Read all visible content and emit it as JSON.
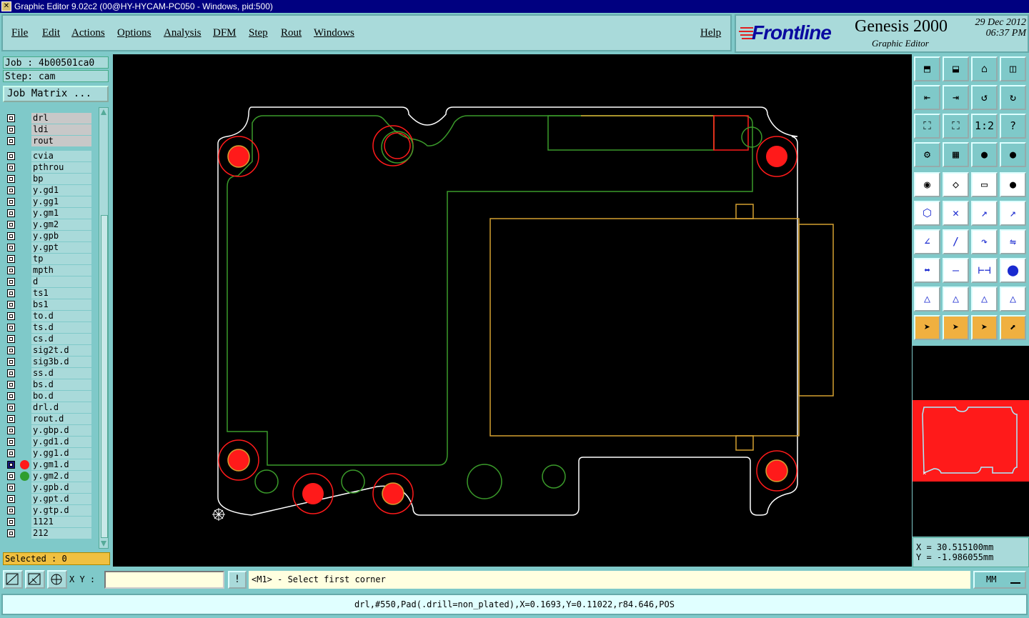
{
  "window": {
    "title": "Graphic Editor 9.02c2 (00@HY-HYCAM-PC050 - Windows, pid:500)"
  },
  "menu": {
    "items": [
      "File",
      "Edit",
      "Actions",
      "Options",
      "Analysis",
      "DFM",
      "Step",
      "Rout",
      "Windows"
    ],
    "help": "Help"
  },
  "brand": {
    "logo": "Frontline",
    "product": "Genesis 2000",
    "subtitle": "Graphic Editor",
    "date": "29 Dec 2012",
    "time": "06:37 PM"
  },
  "job": {
    "job_label": "Job : 4b00501ca0",
    "step_label": "Step: cam",
    "matrix_button": "Job Matrix ..."
  },
  "layers": [
    {
      "name": "drl",
      "style": "grey"
    },
    {
      "name": "ldi",
      "style": "grey"
    },
    {
      "name": "rout",
      "style": "grey"
    },
    {
      "name": "cvia"
    },
    {
      "name": "pthrou"
    },
    {
      "name": "bp"
    },
    {
      "name": "y.gd1"
    },
    {
      "name": "y.gg1"
    },
    {
      "name": "y.gm1"
    },
    {
      "name": "y.gm2"
    },
    {
      "name": "y.gpb"
    },
    {
      "name": "y.gpt"
    },
    {
      "name": "tp"
    },
    {
      "name": "mpth"
    },
    {
      "name": "d"
    },
    {
      "name": "ts1"
    },
    {
      "name": "bs1"
    },
    {
      "name": "to.d"
    },
    {
      "name": "ts.d"
    },
    {
      "name": "cs.d"
    },
    {
      "name": "sig2t.d"
    },
    {
      "name": "sig3b.d"
    },
    {
      "name": "ss.d"
    },
    {
      "name": "bs.d"
    },
    {
      "name": "bo.d"
    },
    {
      "name": "drl.d"
    },
    {
      "name": "rout.d"
    },
    {
      "name": "y.gbp.d"
    },
    {
      "name": "y.gd1.d"
    },
    {
      "name": "y.gg1.d"
    },
    {
      "name": "y.gm1.d",
      "color": "#ff1a1a",
      "selected": true
    },
    {
      "name": "y.gm2.d",
      "color": "#2e9e2e"
    },
    {
      "name": "y.gpb.d"
    },
    {
      "name": "y.gpt.d"
    },
    {
      "name": "y.gtp.d"
    },
    {
      "name": "1121"
    },
    {
      "name": "212"
    }
  ],
  "selected_status": "Selected : 0",
  "coords": {
    "x": "X  = 30.515100mm",
    "y": "Y  = -1.986055mm"
  },
  "xy": {
    "label": "X Y :",
    "value": ""
  },
  "message": "<M1> - Select first corner",
  "units": "MM",
  "status": "drl,#550,Pad(.drill=non_plated),X=0.1693,Y=0.11022,r84.646,POS",
  "colors": {
    "panel": "#7fc9c9",
    "canvas": "#000000",
    "board_outline": "#ffffff",
    "green_layer": "#3a9a2a",
    "red_layer": "#ff1a1a",
    "orange_layer": "#d4a030"
  },
  "icons": [
    "home-view-icon",
    "zoom-icon",
    "pan-icon",
    "fit-icon",
    "measure-icon",
    "snap-icon",
    "grid-icon",
    "selection-icon",
    "ruler-icon",
    "pad-icon",
    "feature-icon",
    "arrow-icon"
  ]
}
